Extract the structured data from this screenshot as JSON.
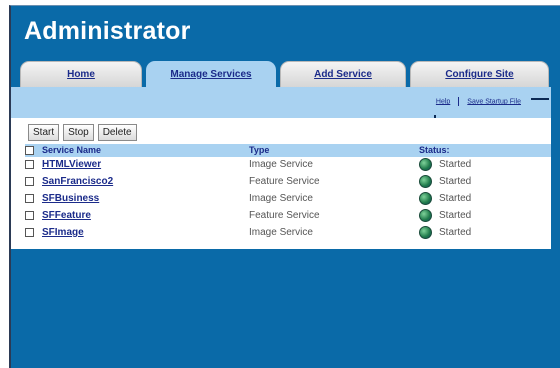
{
  "app": {
    "title": "Administrator"
  },
  "tabs": [
    {
      "label": "Home",
      "active": false
    },
    {
      "label": "Manage Services",
      "active": true
    },
    {
      "label": "Add Service",
      "active": false
    },
    {
      "label": "Configure Site",
      "active": false
    }
  ],
  "subnav": {
    "help_label": "Help",
    "save_label": "Save Startup File"
  },
  "toolbar": {
    "start_label": "Start",
    "stop_label": "Stop",
    "delete_label": "Delete"
  },
  "table": {
    "headers": {
      "name": "Service Name",
      "type": "Type",
      "status": "Status:"
    },
    "rows": [
      {
        "name": "HTMLViewer",
        "type": "Image Service",
        "status": "Started"
      },
      {
        "name": "SanFrancisco2",
        "type": "Feature Service",
        "status": "Started"
      },
      {
        "name": "SFBusiness",
        "type": "Image Service",
        "status": "Started"
      },
      {
        "name": "SFFeature",
        "type": "Feature Service",
        "status": "Started"
      },
      {
        "name": "SFImage",
        "type": "Image Service",
        "status": "Started"
      }
    ]
  },
  "colors": {
    "frame_blue": "#0a6aa8",
    "tab_active": "#a9d2f1",
    "link_blue": "#1b2b8a"
  },
  "icons": {
    "status": "globe-icon"
  }
}
